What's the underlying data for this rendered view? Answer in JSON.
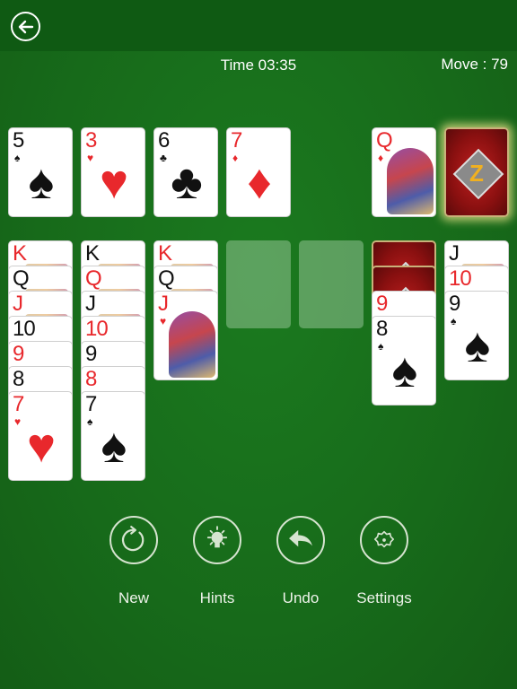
{
  "header": {
    "back_label": "Back",
    "time_label": "Time 03:35",
    "move_label": "Move : 79"
  },
  "foundations": [
    {
      "rank": "5",
      "suit": "♠",
      "color": "black"
    },
    {
      "rank": "3",
      "suit": "♥",
      "color": "red"
    },
    {
      "rank": "6",
      "suit": "♣",
      "color": "black"
    },
    {
      "rank": "7",
      "suit": "♦",
      "color": "red"
    }
  ],
  "waste": {
    "rank": "Q",
    "suit": "♦",
    "color": "red"
  },
  "stock": {
    "label": "Z",
    "state": "face-down"
  },
  "tableau": [
    {
      "cards": [
        {
          "rank": "K",
          "color": "red"
        },
        {
          "rank": "Q",
          "color": "black"
        },
        {
          "rank": "J",
          "color": "red"
        },
        {
          "rank": "10",
          "color": "black"
        },
        {
          "rank": "9",
          "color": "red"
        },
        {
          "rank": "8",
          "color": "black"
        },
        {
          "rank": "7",
          "suit": "♥",
          "color": "red"
        }
      ]
    },
    {
      "cards": [
        {
          "rank": "K",
          "color": "black"
        },
        {
          "rank": "Q",
          "color": "red"
        },
        {
          "rank": "J",
          "color": "black"
        },
        {
          "rank": "10",
          "color": "red"
        },
        {
          "rank": "9",
          "color": "black"
        },
        {
          "rank": "8",
          "color": "red"
        },
        {
          "rank": "7",
          "suit": "♠",
          "color": "black"
        }
      ]
    },
    {
      "cards": [
        {
          "rank": "K",
          "color": "red"
        },
        {
          "rank": "Q",
          "color": "black"
        },
        {
          "rank": "J",
          "suit": "♥",
          "color": "red"
        }
      ]
    },
    {
      "cards": []
    },
    {
      "cards": []
    },
    {
      "facedown": 2,
      "cards": [
        {
          "rank": "9",
          "color": "red"
        },
        {
          "rank": "8",
          "suit": "♠",
          "color": "black"
        }
      ]
    },
    {
      "cards": [
        {
          "rank": "J",
          "color": "black"
        },
        {
          "rank": "10",
          "color": "red"
        },
        {
          "rank": "9",
          "suit": "♠",
          "color": "black"
        }
      ]
    }
  ],
  "controls": [
    {
      "label": "New",
      "icon": "restart-icon"
    },
    {
      "label": "Hints",
      "icon": "lightbulb-icon"
    },
    {
      "label": "Undo",
      "icon": "undo-icon"
    },
    {
      "label": "Settings",
      "icon": "gear-icon"
    }
  ]
}
